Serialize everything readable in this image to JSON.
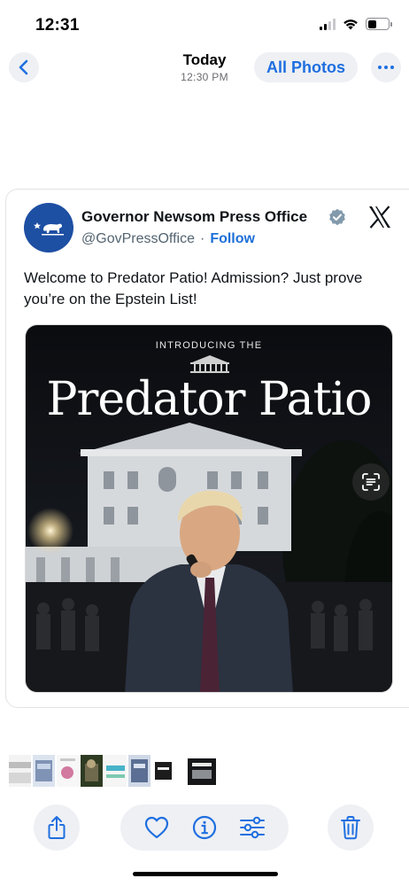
{
  "status_bar": {
    "time": "12:31",
    "signal_bars_active": 2,
    "battery_level": 0.45
  },
  "nav": {
    "title": "Today",
    "subtitle": "12:30 PM",
    "all_photos_label": "All Photos",
    "accent_color": "#1f6fe0"
  },
  "tweet": {
    "author_name": "Governor Newsom Press Office",
    "handle": "@GovPressOffice",
    "separator": "·",
    "follow_label": "Follow",
    "text": "Welcome to Predator Patio! Admission? Just prove you’re on the Epstein List!",
    "image": {
      "kicker": "INTRODUCING THE",
      "headline": "Predator Patio"
    },
    "icons": [
      "bear-flag-avatar-icon",
      "verified-badge-icon",
      "x-logo-icon",
      "live-text-icon"
    ]
  },
  "toolbar": {
    "icons": [
      "share-icon",
      "heart-icon",
      "info-icon",
      "adjust-icon",
      "trash-icon"
    ]
  },
  "thumbnails": {
    "count": 9,
    "selected_index": 8
  }
}
